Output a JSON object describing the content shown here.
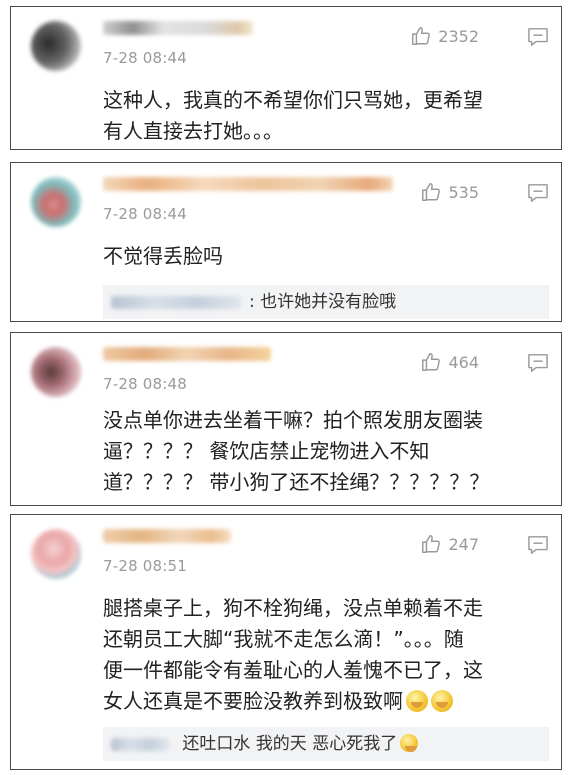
{
  "comments": [
    {
      "time": "7-28 08:44",
      "likes": "2352",
      "text_lines": [
        "这种人，我真的不希望你们只骂她，更希望",
        "有人直接去打她。。。"
      ]
    },
    {
      "time": "7-28 08:44",
      "likes": "535",
      "text_lines": [
        "不觉得丢脸吗"
      ],
      "reply": "也许她并没有脸哦",
      "reply_sep": ":"
    },
    {
      "time": "7-28 08:48",
      "likes": "464",
      "text_lines": [
        "没点单你进去坐着干嘛？拍个照发朋友圈装",
        "逼？？？？ 餐饮店禁止宠物进入不知",
        "道？？？？ 带小狗了还不拴绳？？？？？？"
      ]
    },
    {
      "time": "7-28 08:51",
      "likes": "247",
      "text_lines": [
        "腿搭桌子上，狗不栓狗绳，没点单赖着不走",
        "还朝员工大脚“我就不走怎么滴！”。。。随",
        "便一件都能令有羞耻心的人羞愧不已了，这",
        "女人还真是不要脸没教养到极致啊"
      ],
      "reply": "还吐口水 我的天 恶心死我了"
    }
  ],
  "icons": {
    "like": "thumbs-up-icon",
    "comment": "comment-icon",
    "emoji": "facepalm-emoji-icon",
    "sick_emoji": "sick-emoji-icon"
  },
  "colors": {
    "border": "#4a4a4a",
    "meta": "#9a9a9a",
    "reply_bg": "#f2f3f5"
  }
}
